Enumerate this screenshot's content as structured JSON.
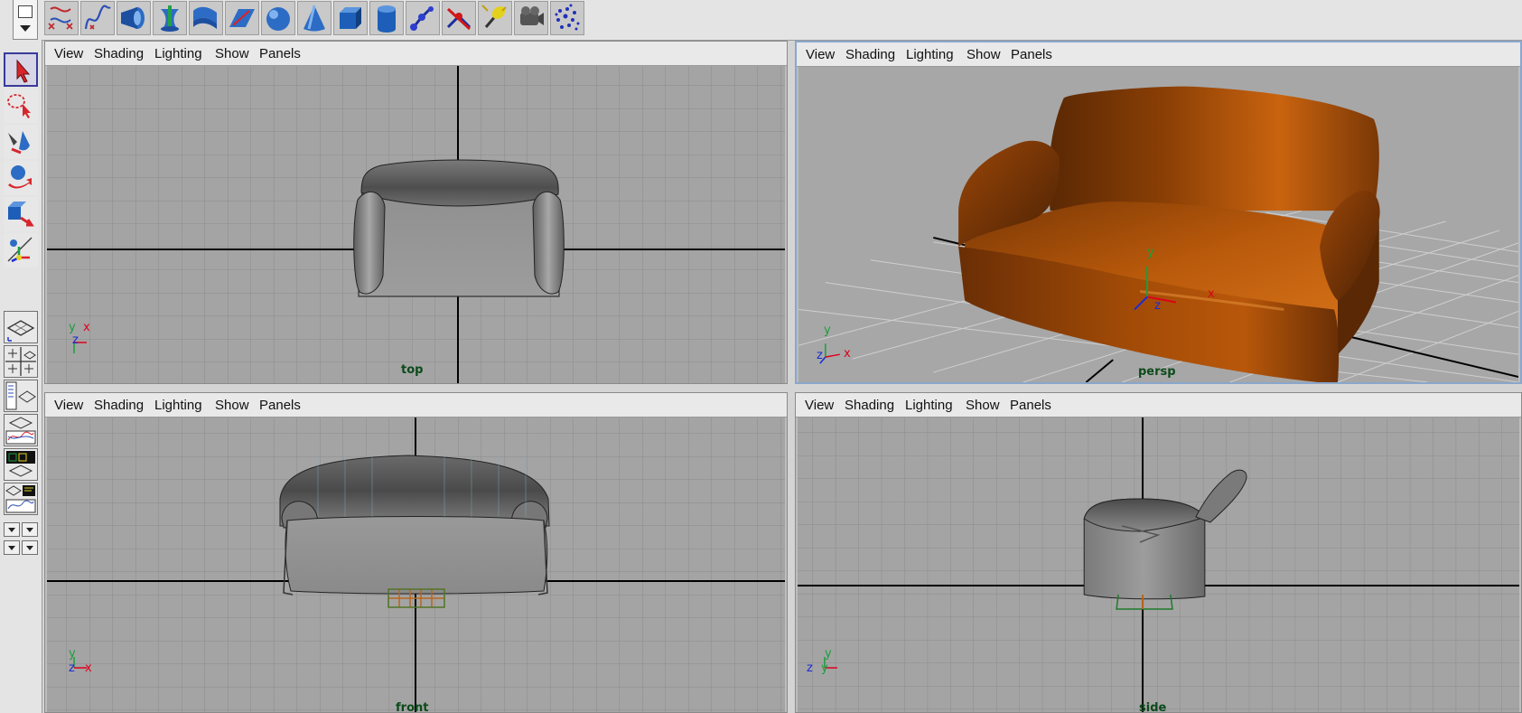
{
  "viewport_menu": {
    "view": "View",
    "shading": "Shading",
    "lighting": "Lighting",
    "show": "Show",
    "panels": "Panels"
  },
  "viewports": {
    "top": {
      "camera": "top"
    },
    "persp": {
      "camera": "persp"
    },
    "front": {
      "camera": "front"
    },
    "side": {
      "camera": "side"
    }
  },
  "axis_labels": {
    "x": "x",
    "y": "y",
    "z": "z"
  },
  "shelf_icons": [
    "curve-tools-icon",
    "cv-curve-icon",
    "revolve-icon",
    "loft-icon",
    "extrude-icon",
    "planar-icon",
    "nurbs-sphere-icon",
    "nurbs-cone-icon",
    "polygon-cube-icon",
    "polygon-cylinder-icon",
    "ik-joint-icon",
    "ik-handle-icon",
    "point-light-icon",
    "camera-icon",
    "particles-icon"
  ],
  "colors": {
    "viewport_bg": "#a4a4a4",
    "grid": "#8c8c8c",
    "axis_line": "#000000",
    "sofa_orange": "#b55508",
    "camera_label": "#0c4a1a",
    "active_border": "#8aa7cc",
    "axis_x": "#e0001b",
    "axis_y": "#1a9e3c",
    "axis_z": "#1a2bd6"
  }
}
